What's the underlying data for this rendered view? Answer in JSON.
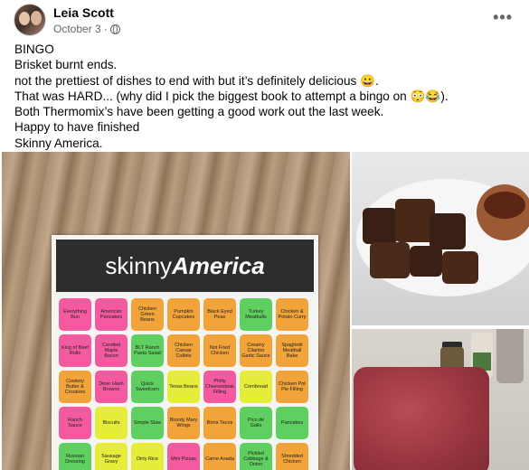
{
  "post": {
    "author": "Leia Scott",
    "date": "October 3",
    "separator": "·",
    "audience_icon": "globe-icon",
    "more_icon": "•••",
    "lines": [
      "BINGO",
      "Brisket burnt ends.",
      "not the prettiest of dishes to end with but it’s definitely delicious 😀.",
      "That was HARD... (why did I pick the biggest book to attempt a bingo on 😳😂).",
      "Both Thermomix’s have been getting a good work out the last week.",
      "Happy to have finished",
      "Skinny America."
    ]
  },
  "photo_main": {
    "banner_light": "skinny",
    "banner_bold": "America",
    "cells": [
      {
        "label": "Everything Bun",
        "color": "#f45aa0"
      },
      {
        "label": "American Pancakes",
        "color": "#f45aa0"
      },
      {
        "label": "Chicken Green Beans",
        "color": "#f2a33a"
      },
      {
        "label": "Pumpkin Cupcakes",
        "color": "#f2a33a"
      },
      {
        "label": "Black Eyed Peas",
        "color": "#f2a33a"
      },
      {
        "label": "Turkey Meatballs",
        "color": "#5fcf5f"
      },
      {
        "label": "Chicken & Potato Curry",
        "color": "#f2a33a"
      },
      {
        "label": "King of Beef Rolls",
        "color": "#f45aa0"
      },
      {
        "label": "Candied Maple Bacon",
        "color": "#f45aa0"
      },
      {
        "label": "BLT Ranch Pasta Salad",
        "color": "#5fcf5f"
      },
      {
        "label": "Chicken Caesar Cutlets",
        "color": "#f2a33a"
      },
      {
        "label": "Not Fried Chicken",
        "color": "#f2a33a"
      },
      {
        "label": "Creamy Cilantro Garlic Sauce",
        "color": "#f2a33a"
      },
      {
        "label": "Spaghetti Meatball Bake",
        "color": "#f2a33a"
      },
      {
        "label": "Cowboy Butter & Croutons",
        "color": "#f2a33a"
      },
      {
        "label": "Diner Hash Browns",
        "color": "#f45aa0"
      },
      {
        "label": "Quick Sweetcorn",
        "color": "#5fcf5f"
      },
      {
        "label": "Texas Beans",
        "color": "#e6ec3a"
      },
      {
        "label": "Philly Cheesesteak Filling",
        "color": "#f45aa0"
      },
      {
        "label": "Cornbread",
        "color": "#e6ec3a"
      },
      {
        "label": "Chicken Pot Pie Filling",
        "color": "#f2a33a"
      },
      {
        "label": "Ranch Sauce",
        "color": "#f45aa0"
      },
      {
        "label": "Biscuits",
        "color": "#e6ec3a"
      },
      {
        "label": "Simple Slaw",
        "color": "#5fcf5f"
      },
      {
        "label": "Bloody Mary Wings",
        "color": "#f2a33a"
      },
      {
        "label": "Birria Tacos",
        "color": "#f2a33a"
      },
      {
        "label": "Pico de Gallo",
        "color": "#5fcf5f"
      },
      {
        "label": "Pancakes",
        "color": "#5fcf5f"
      },
      {
        "label": "Russian Dressing",
        "color": "#5fcf5f"
      },
      {
        "label": "Sausage Gravy",
        "color": "#e6ec3a"
      },
      {
        "label": "Dirty Rice",
        "color": "#e6ec3a"
      },
      {
        "label": "Mini Pizzas",
        "color": "#f45aa0"
      },
      {
        "label": "Carne Asada",
        "color": "#f2a33a"
      },
      {
        "label": "Pickled Cabbage & Onion",
        "color": "#5fcf5f"
      },
      {
        "label": "Shredded Chicken",
        "color": "#f2a33a"
      }
    ]
  }
}
